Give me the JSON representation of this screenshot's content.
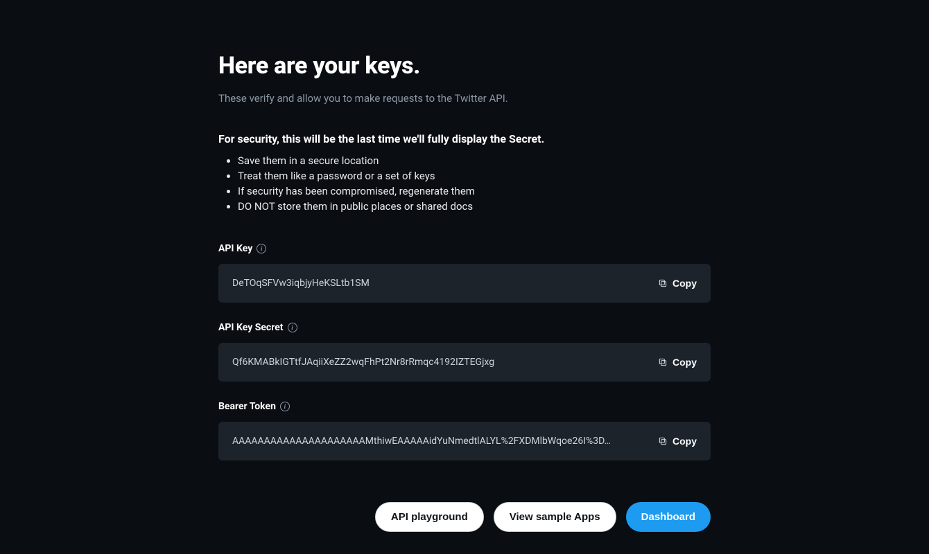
{
  "page": {
    "title": "Here are your keys.",
    "subtitle": "These verify and allow you to make requests to the Twitter API.",
    "security_heading": "For security, this will be the last time we'll fully display the Secret.",
    "tips": [
      "Save them in a secure location",
      "Treat them like a password or a set of keys",
      "If security has been compromised, regenerate them",
      "DO NOT store them in public places or shared docs"
    ]
  },
  "fields": {
    "api_key": {
      "label": "API Key",
      "value": "DeTOqSFVw3iqbjyHeKSLtb1SM",
      "copy_label": "Copy"
    },
    "api_key_secret": {
      "label": "API Key Secret",
      "value": "Qf6KMABkIGTtfJAqiiXeZZ2wqFhPt2Nr8rRmqc4192IZTEGjxg",
      "copy_label": "Copy"
    },
    "bearer_token": {
      "label": "Bearer Token",
      "value": "AAAAAAAAAAAAAAAAAAAAAMthiwEAAAAAidYuNmedtlALYL%2FXDMlbWqoe26I%3D…",
      "copy_label": "Copy"
    }
  },
  "footer": {
    "api_playground": "API playground",
    "view_sample_apps": "View sample Apps",
    "dashboard": "Dashboard"
  },
  "colors": {
    "background": "#0a0d12",
    "box": "#1c232b",
    "muted": "#8b98a5",
    "accent": "#1d9bf0"
  }
}
